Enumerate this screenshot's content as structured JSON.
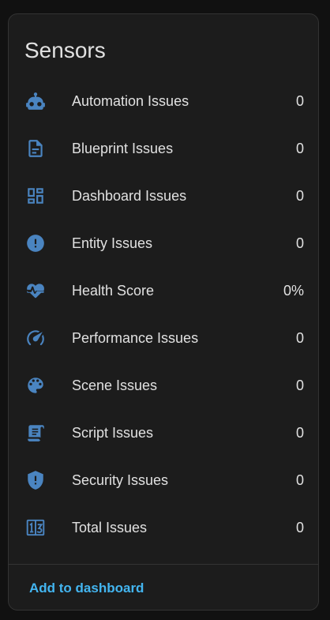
{
  "card": {
    "title": "Sensors",
    "icon_color": "#4a84c0",
    "action_color": "#43b5f0",
    "rows": [
      {
        "icon": "robot-icon",
        "label": "Automation Issues",
        "value": "0"
      },
      {
        "icon": "file-document-icon",
        "label": "Blueprint Issues",
        "value": "0"
      },
      {
        "icon": "view-dashboard-icon",
        "label": "Dashboard Issues",
        "value": "0"
      },
      {
        "icon": "alert-circle-icon",
        "label": "Entity Issues",
        "value": "0"
      },
      {
        "icon": "heart-pulse-icon",
        "label": "Health Score",
        "value": "0%"
      },
      {
        "icon": "speedometer-icon",
        "label": "Performance Issues",
        "value": "0"
      },
      {
        "icon": "palette-icon",
        "label": "Scene Issues",
        "value": "0"
      },
      {
        "icon": "script-icon",
        "label": "Script Issues",
        "value": "0"
      },
      {
        "icon": "shield-alert-icon",
        "label": "Security Issues",
        "value": "0"
      },
      {
        "icon": "numeric-box-icon",
        "label": "Total Issues",
        "value": "0"
      }
    ],
    "action_label": "Add to dashboard"
  }
}
